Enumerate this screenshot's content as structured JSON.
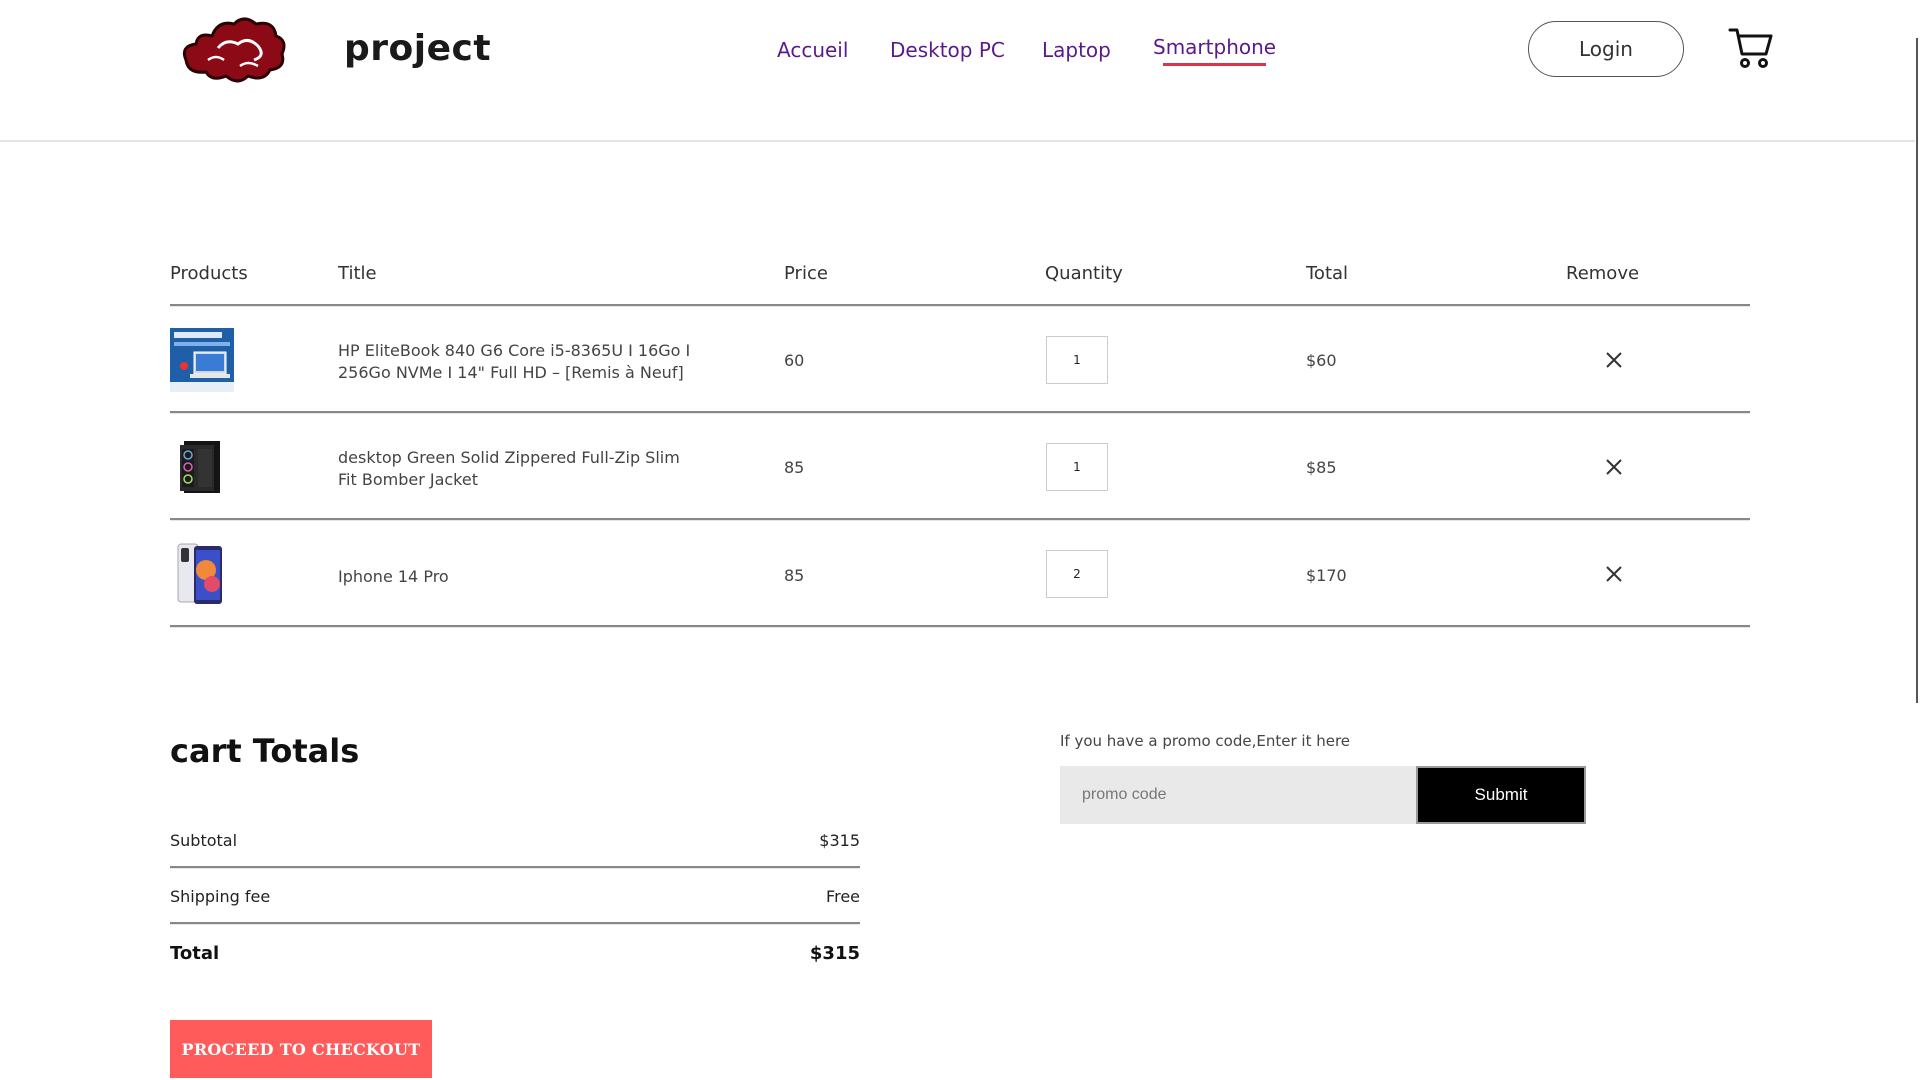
{
  "header": {
    "brand": "project",
    "nav": [
      {
        "label": "Accueil",
        "active": false
      },
      {
        "label": "Desktop PC",
        "active": false
      },
      {
        "label": "Laptop",
        "active": false
      },
      {
        "label": "Smartphone",
        "active": true
      }
    ],
    "login_label": "Login"
  },
  "cart": {
    "columns": [
      "Products",
      "Title",
      "Price",
      "Quantity",
      "Total",
      "Remove"
    ],
    "items": [
      {
        "title": "HP EliteBook 840 G6 Core i5-8365U I 16Go I 256Go NVMe I 14\" Full HD – [Remis à Neuf]",
        "price": "60",
        "quantity": "1",
        "total": "$60",
        "thumb_icon": "laptop-thumb-icon"
      },
      {
        "title": "desktop Green Solid Zippered Full-Zip Slim Fit Bomber Jacket",
        "price": "85",
        "quantity": "1",
        "total": "$85",
        "thumb_icon": "desktop-tower-thumb-icon"
      },
      {
        "title": "Iphone 14 Pro",
        "price": "85",
        "quantity": "2",
        "total": "$170",
        "thumb_icon": "smartphone-thumb-icon"
      }
    ]
  },
  "totals": {
    "title": "cart Totals",
    "subtotal_label": "Subtotal",
    "subtotal_value": "$315",
    "shipping_label": "Shipping fee",
    "shipping_value": "Free",
    "total_label": "Total",
    "total_value": "$315",
    "checkout_label": "PROCEED TO CHECKOUT"
  },
  "promo": {
    "label": "If you have a promo code,Enter it here",
    "placeholder": "promo code",
    "submit_label": "Submit"
  },
  "colors": {
    "nav_text": "#5a1a8c",
    "nav_underline": "#e0334a",
    "checkout_bg": "#ff5b5b",
    "logo_red": "#8b0a16"
  },
  "icons": {
    "logo": "red-cloud-logo-icon",
    "cart": "shopping-cart-icon",
    "remove": "close-icon"
  }
}
